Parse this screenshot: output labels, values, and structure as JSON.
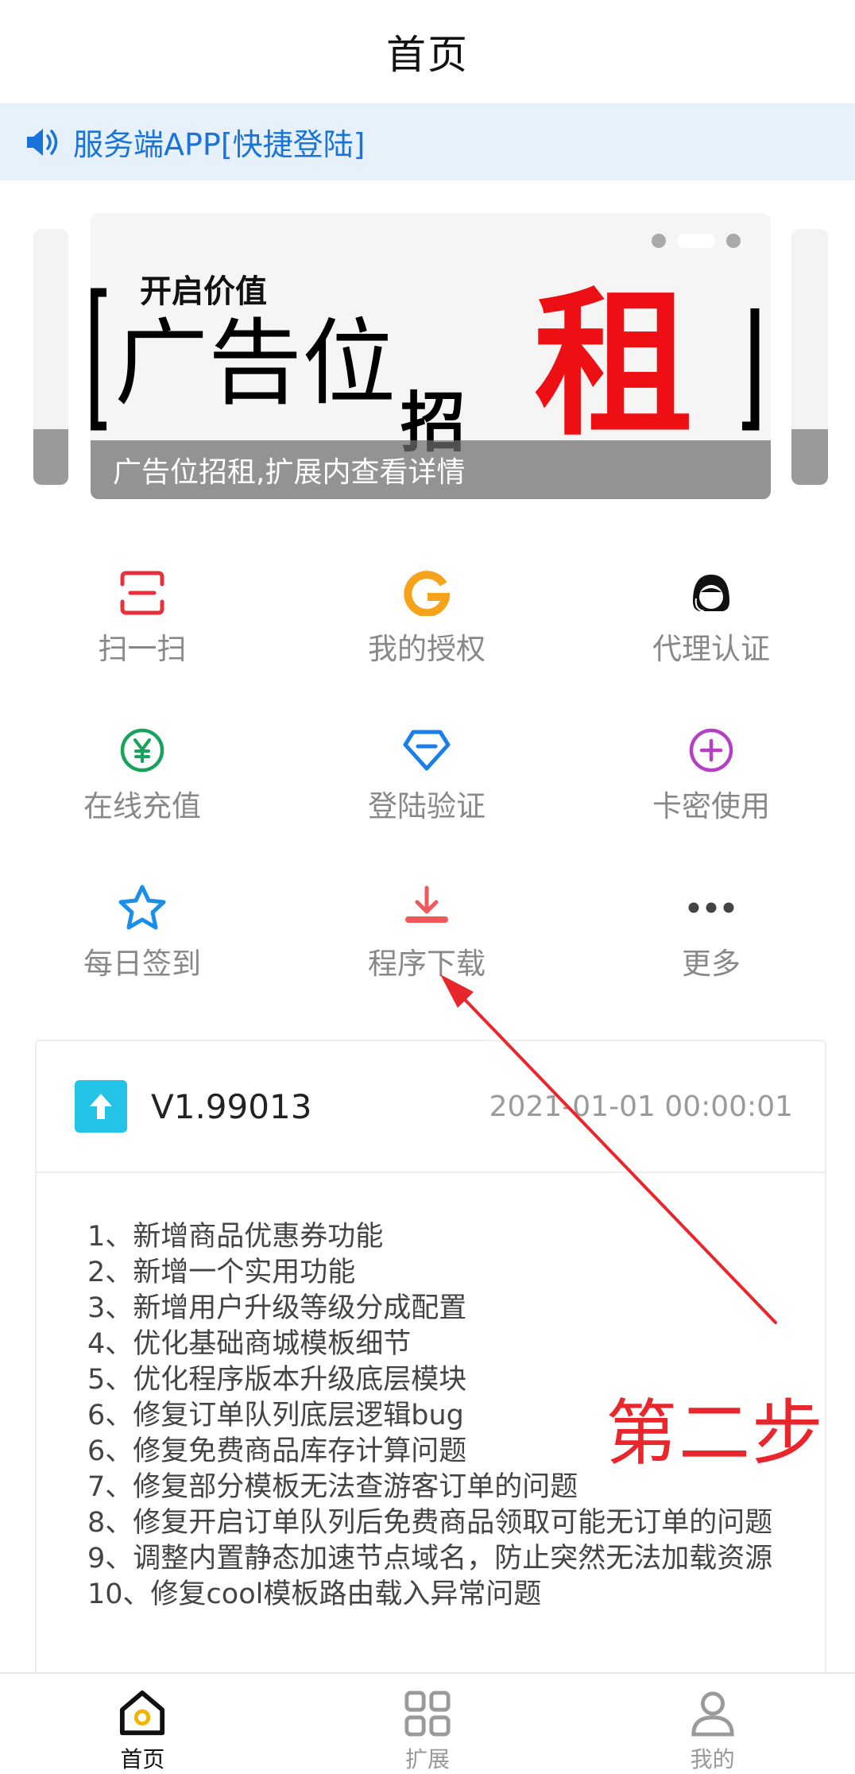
{
  "header": {
    "title": "首页"
  },
  "notice": {
    "text": "服务端APP[快捷登陆]"
  },
  "banner": {
    "tag_small": "开启价值",
    "headline_part1": "广告位",
    "headline_part2": "招",
    "headline_part3": "租",
    "caption": "广告位招租,扩展内查看详情"
  },
  "grid": {
    "items": [
      {
        "label": "扫一扫",
        "icon": "scan-icon",
        "color": "#e8303a"
      },
      {
        "label": "我的授权",
        "icon": "g-logo-icon",
        "color": "#f7a21b"
      },
      {
        "label": "代理认证",
        "icon": "agent-avatar-icon",
        "color": "#222222"
      },
      {
        "label": "在线充值",
        "icon": "yuan-icon",
        "color": "#17a35c"
      },
      {
        "label": "登陆验证",
        "icon": "diamond-icon",
        "color": "#1a7fe8"
      },
      {
        "label": "卡密使用",
        "icon": "plus-circle-icon",
        "color": "#b43fc4"
      },
      {
        "label": "每日签到",
        "icon": "star-icon",
        "color": "#1a8fe8"
      },
      {
        "label": "程序下载",
        "icon": "download-icon",
        "color": "#f0575a"
      },
      {
        "label": "更多",
        "icon": "more-icon",
        "color": "#444444"
      }
    ]
  },
  "release": {
    "version": "V1.99013",
    "date": "2021-01-01 00:00:01",
    "notes": [
      "1、新增商品优惠券功能",
      "2、新增一个实用功能",
      "3、新增用户升级等级分成配置",
      "4、优化基础商城模板细节",
      "5、优化程序版本升级底层模块",
      "6、修复订单队列底层逻辑bug",
      "6、修复免费商品库存计算问题",
      "7、修复部分模板无法查游客订单的问题",
      "8、修复开启订单队列后免费商品领取可能无订单的问题",
      "9、调整内置静态加速节点域名，防止突然无法加载资源",
      "10、修复cool模板路由载入异常问题"
    ]
  },
  "annotation": {
    "text": "第二步",
    "color": "#e8262c"
  },
  "tabbar": {
    "tabs": [
      {
        "label": "首页",
        "icon": "home-icon",
        "active": true
      },
      {
        "label": "扩展",
        "icon": "grid-icon",
        "active": false
      },
      {
        "label": "我的",
        "icon": "user-icon",
        "active": false
      }
    ]
  }
}
